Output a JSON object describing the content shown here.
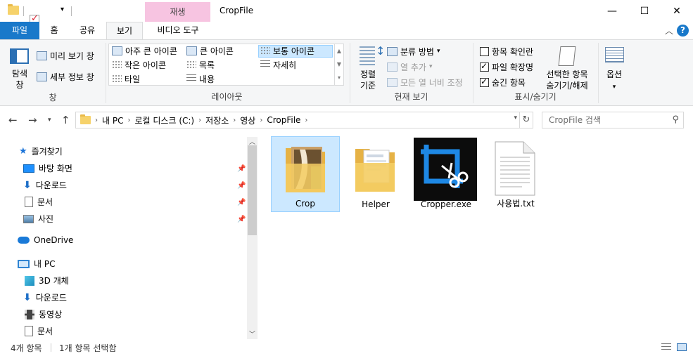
{
  "window": {
    "title": "CropFile",
    "context_tab": "재생",
    "minimize": "—",
    "maximize": "☐",
    "close": "✕"
  },
  "ribbon_tabs": {
    "file": "파일",
    "home": "홈",
    "share": "공유",
    "view": "보기",
    "video_tools": "비디오 도구"
  },
  "ribbon": {
    "pane_group": {
      "nav_pane": "탐색\n창",
      "preview": "미리 보기 창",
      "details": "세부 정보 창",
      "label": "창"
    },
    "layout_group": {
      "items": [
        "아주 큰 아이콘",
        "큰 아이콘",
        "보통 아이콘",
        "작은 아이콘",
        "목록",
        "자세히",
        "타일",
        "내용"
      ],
      "selected": "보통 아이콘",
      "label": "레이아웃"
    },
    "current_view_group": {
      "sort": "정렬\n기준",
      "group_by": "분류 방법",
      "add_columns": "열 추가",
      "fit_columns": "모든 열 너비 조정",
      "label": "현재 보기"
    },
    "show_hide_group": {
      "item_checkboxes": "항목 확인란",
      "file_extensions": "파일 확장명",
      "hidden_items": "숨긴 항목",
      "hide_selected": "선택한 항목\n숨기기/해제",
      "label": "표시/숨기기",
      "checked": {
        "item_checkboxes": false,
        "file_extensions": true,
        "hidden_items": true
      }
    },
    "options": "옵션"
  },
  "address": {
    "crumbs": [
      "내 PC",
      "로컬 디스크 (C:)",
      "저장소",
      "영상",
      "CropFile"
    ],
    "search_placeholder": "CropFile 검색"
  },
  "nav_pane": {
    "quick_access": "즐겨찾기",
    "items": [
      {
        "label": "바탕 화면",
        "icon": "desktop-icon"
      },
      {
        "label": "다운로드",
        "icon": "download-icon"
      },
      {
        "label": "문서",
        "icon": "document-icon"
      },
      {
        "label": "사진",
        "icon": "pictures-icon"
      }
    ],
    "onedrive": "OneDrive",
    "this_pc": "내 PC",
    "pc_items": [
      {
        "label": "3D 개체",
        "icon": "3d-objects-icon"
      },
      {
        "label": "다운로드",
        "icon": "download-icon"
      },
      {
        "label": "동영상",
        "icon": "videos-icon"
      },
      {
        "label": "문서",
        "icon": "document-icon"
      }
    ]
  },
  "files": [
    {
      "name": "Crop",
      "type": "folder-with-image",
      "selected": true
    },
    {
      "name": "Helper",
      "type": "folder",
      "selected": false
    },
    {
      "name": "Cropper.exe",
      "type": "exe-crop-icon",
      "selected": false
    },
    {
      "name": "사용법.txt",
      "type": "text-file",
      "selected": false
    }
  ],
  "status": {
    "count": "4개 항목",
    "selection": "1개 항목 선택함"
  },
  "colors": {
    "accent": "#1979ca",
    "selection": "#cce8ff",
    "context_tab": "#f7c4e1"
  }
}
